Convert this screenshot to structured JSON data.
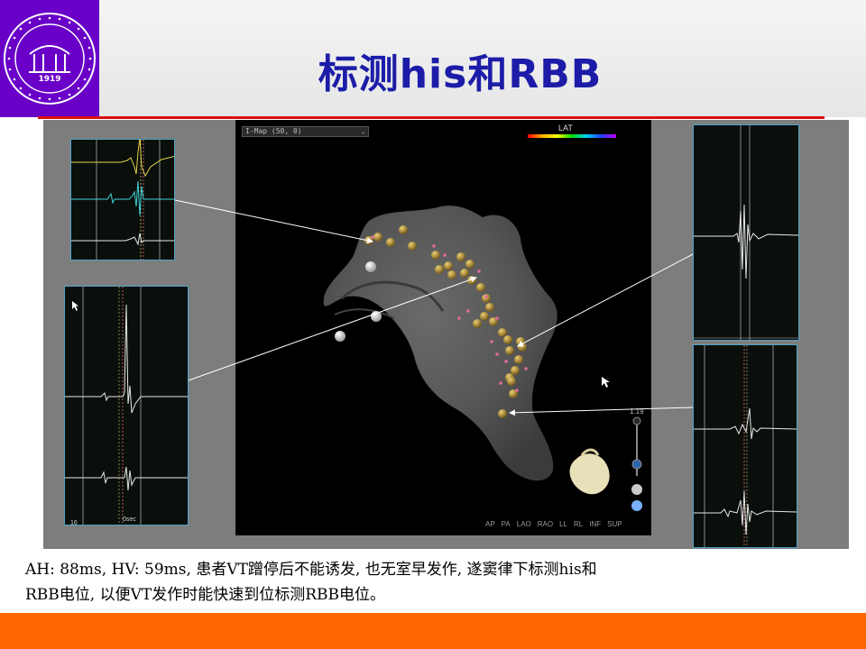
{
  "slide": {
    "title": "标测his和RBB",
    "caption_line1": "AH: 88ms, HV: 59ms, 患者VT蹭停后不能诱发, 也无室早发作, 遂窦律下标测his和",
    "caption_line2": "RBB电位, 以便VT发作时能快速到位标测RBB电位。"
  },
  "logo": {
    "year": "1919",
    "ring_text": "THE FIRST AFFILIATED HOSPITAL OF ZHENGZHOU UNIVERSITY"
  },
  "mapping": {
    "map_dropdown": "I-Map (50, 0)",
    "legend_label": "LAT",
    "zoom_value": "1.19",
    "view_buttons": [
      "AP",
      "PA",
      "LAO",
      "RAO",
      "LL",
      "RL",
      "INF",
      "SUP"
    ]
  },
  "electrogram_labels": {
    "left_bottom_speed": "0sec",
    "left_bottom_index": "16"
  },
  "colors": {
    "logo_bg": "#6a00c8",
    "title": "#1c1ca8",
    "rule": "#d81010",
    "footer": "#ff6600",
    "figure_bg": "#7d7d7d",
    "egm_border": "#4ea3c9",
    "ablation_point": "#a8893a",
    "marker_pink": "#e06aa0"
  }
}
